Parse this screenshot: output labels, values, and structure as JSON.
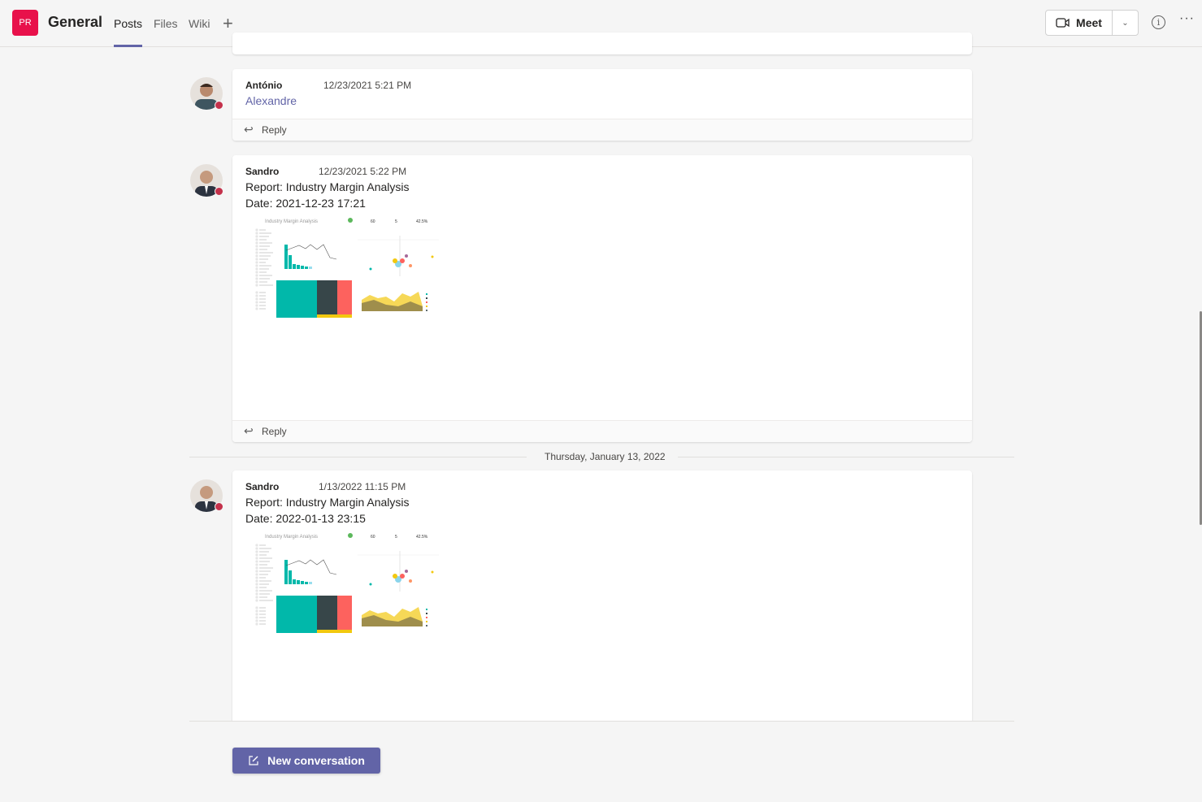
{
  "header": {
    "logo": "PR",
    "title": "General",
    "tabs": [
      {
        "label": "Posts",
        "active": true
      },
      {
        "label": "Files"
      },
      {
        "label": "Wiki"
      }
    ],
    "add_tab_icon": "plus-icon",
    "meet_label": "Meet",
    "icons": [
      "video-camera-icon",
      "chevron-down-icon",
      "info-icon",
      "more-icon"
    ]
  },
  "accent": "#6264a7",
  "messages": [
    {
      "author": "António",
      "time": "12/23/2021 5:21 PM",
      "lines": [
        "Alexandre"
      ],
      "reply": "Reply"
    },
    {
      "author": "Sandro",
      "time": "12/23/2021 5:22 PM",
      "lines": [
        "Report: Industry Margin Analysis",
        "Date: 2021-12-23 17:21"
      ],
      "reply": "Reply",
      "attachment": "Industry Margin Analysis"
    },
    {
      "author": "Sandro",
      "time": "1/13/2022 11:15 PM",
      "lines": [
        "Report: Industry Margin Analysis",
        "Date: 2022-01-13 23:15"
      ],
      "attachment": "Industry Margin Analysis"
    }
  ],
  "date_divider": "Thursday, January 13, 2022",
  "thumb": {
    "kpis": [
      "60",
      "5",
      "42.5%"
    ]
  },
  "new_conversation": "New conversation"
}
